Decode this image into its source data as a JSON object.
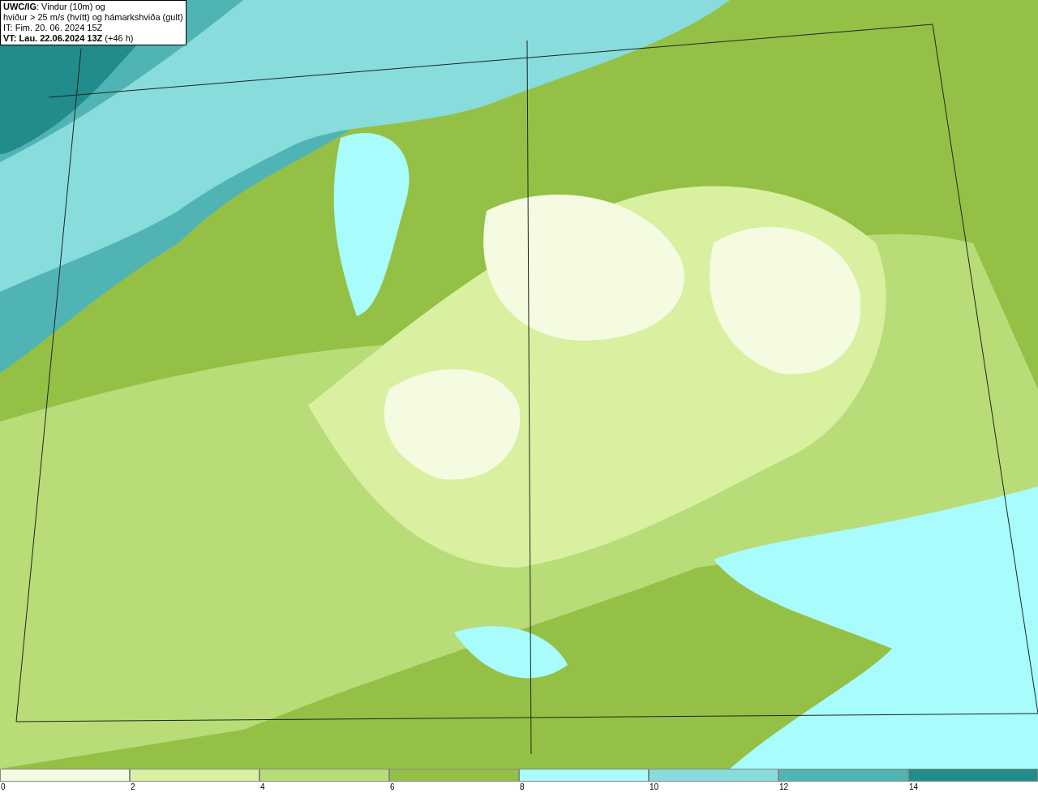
{
  "header": {
    "lines": [
      "**UWC/IG**: Vindur (10m) og",
      "hviður > 25 m/s (hvítt) og hámarkshviða (gult)",
      "IT: Fim. 20. 06. 2024 15Z",
      "**VT: Lau. 22.06.2024 13Z** (+46 h)"
    ]
  },
  "legend": {
    "bins": [
      {
        "label": "0",
        "color": "#f4fbe0"
      },
      {
        "label": "2",
        "color": "#d8f0a0"
      },
      {
        "label": "4",
        "color": "#b8dc78"
      },
      {
        "label": "6",
        "color": "#94c046"
      },
      {
        "label": "8",
        "color": "#a8fcfc"
      },
      {
        "label": "10",
        "color": "#88dcdc"
      },
      {
        "label": "12",
        "color": "#50b4b4"
      },
      {
        "label": "14",
        "color": "#228c8c"
      }
    ]
  }
}
